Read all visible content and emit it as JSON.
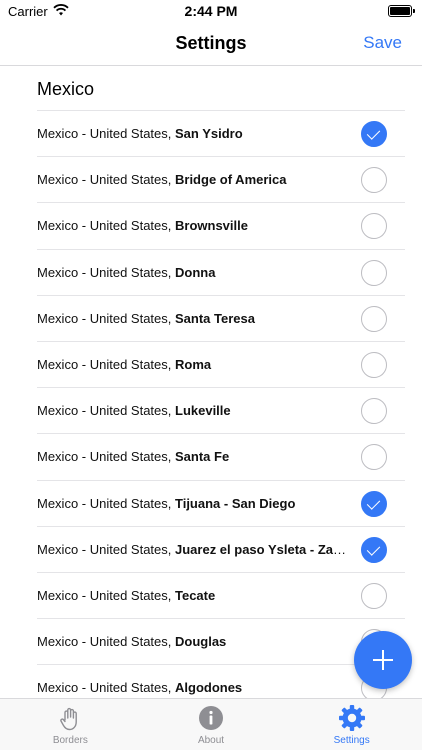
{
  "status_bar": {
    "carrier": "Carrier",
    "time": "2:44 PM"
  },
  "nav": {
    "title": "Settings",
    "save_label": "Save"
  },
  "section": {
    "title": "Mexico"
  },
  "rows": [
    {
      "prefix": "Mexico - United States, ",
      "crossing": "San Ysidro",
      "checked": true
    },
    {
      "prefix": "Mexico - United States, ",
      "crossing": "Bridge of America",
      "checked": false
    },
    {
      "prefix": "Mexico - United States, ",
      "crossing": "Brownsville",
      "checked": false
    },
    {
      "prefix": "Mexico - United States, ",
      "crossing": "Donna",
      "checked": false
    },
    {
      "prefix": "Mexico - United States, ",
      "crossing": "Santa Teresa",
      "checked": false
    },
    {
      "prefix": "Mexico - United States, ",
      "crossing": "Roma",
      "checked": false
    },
    {
      "prefix": "Mexico - United States, ",
      "crossing": "Lukeville",
      "checked": false
    },
    {
      "prefix": "Mexico - United States, ",
      "crossing": "Santa Fe",
      "checked": false
    },
    {
      "prefix": "Mexico - United States, ",
      "crossing": "Tijuana - San Diego",
      "checked": true
    },
    {
      "prefix": "Mexico - United States, ",
      "crossing": "Juarez el paso Ysleta - Zaragoza",
      "checked": true
    },
    {
      "prefix": "Mexico - United States, ",
      "crossing": "Tecate",
      "checked": false
    },
    {
      "prefix": "Mexico - United States, ",
      "crossing": "Douglas",
      "checked": false
    },
    {
      "prefix": "Mexico - United States, ",
      "crossing": "Algodones",
      "checked": false
    }
  ],
  "tabs": [
    {
      "label": "Borders",
      "icon": "hand-icon",
      "active": false
    },
    {
      "label": "About",
      "icon": "info-icon",
      "active": false
    },
    {
      "label": "Settings",
      "icon": "gear-icon",
      "active": true
    }
  ],
  "colors": {
    "accent": "#3478f6",
    "inactive": "#8e8e93"
  }
}
